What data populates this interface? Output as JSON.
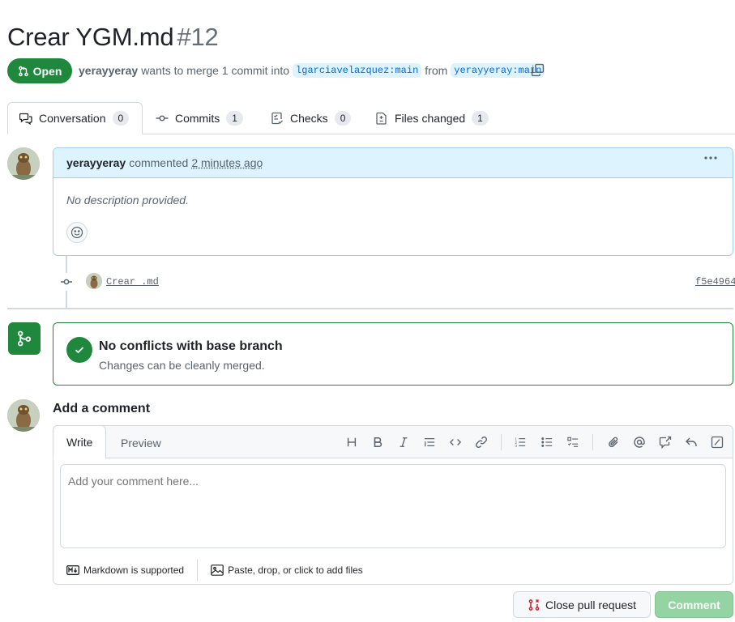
{
  "pr": {
    "title": "Crear YGM.md",
    "number": "#12",
    "state": "Open",
    "author": "yerayyeray",
    "summary_mid": "wants to merge 1 commit into",
    "base_branch": "lgarciavelazquez:main",
    "from_word": "from",
    "head_branch": "yerayyeray:main"
  },
  "tabs": [
    {
      "label": "Conversation",
      "count": "0"
    },
    {
      "label": "Commits",
      "count": "1"
    },
    {
      "label": "Checks",
      "count": "0"
    },
    {
      "label": "Files changed",
      "count": "1"
    }
  ],
  "comment": {
    "author": "yerayyeray",
    "action": "commented",
    "time": "2 minutes ago",
    "body": "No description provided."
  },
  "commit": {
    "message": "Crear .md",
    "sha": "f5e4964"
  },
  "merge": {
    "title": "No conflicts with base branch",
    "subtitle": "Changes can be cleanly merged."
  },
  "composer": {
    "heading": "Add a comment",
    "tab_write": "Write",
    "tab_preview": "Preview",
    "placeholder": "Add your comment here...",
    "markdown_note": "Markdown is supported",
    "attach_note": "Paste, drop, or click to add files"
  },
  "actions": {
    "close_label": "Close pull request",
    "comment_label": "Comment"
  },
  "colors": {
    "open_green": "#1f883d",
    "link_blue": "#0969da",
    "comment_header_bg": "#ddf4ff",
    "disabled_green": "#94d3a2",
    "close_red": "#cf222e"
  }
}
